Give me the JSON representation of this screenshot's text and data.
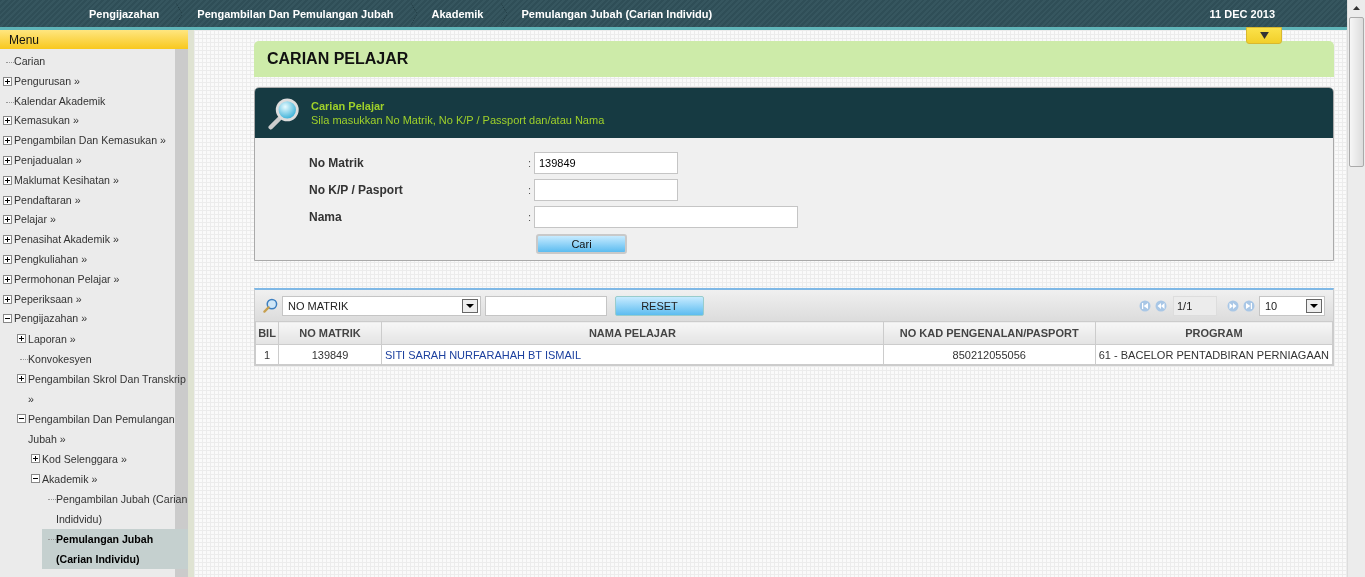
{
  "breadcrumb": [
    {
      "label": "Pengijazahan"
    },
    {
      "label": "Pengambilan Dan Pemulangan Jubah"
    },
    {
      "label": "Akademik"
    },
    {
      "label": "Pemulangan Jubah (Carian Individu)"
    }
  ],
  "date": "11 DEC 2013",
  "sidebar": {
    "title": "Menu",
    "items": [
      {
        "label": "Carian",
        "kind": "leaf",
        "selected": false
      },
      {
        "label": "Pengurusan »",
        "kind": "folder",
        "expanded": false,
        "selected": false
      },
      {
        "label": "Kalendar Akademik",
        "kind": "leaf",
        "selected": false
      },
      {
        "label": "Kemasukan »",
        "kind": "folder",
        "expanded": false,
        "selected": false
      },
      {
        "label": "Pengambilan Dan Kemasukan »",
        "kind": "folder",
        "expanded": false,
        "selected": false
      },
      {
        "label": "Penjadualan »",
        "kind": "folder",
        "expanded": false,
        "selected": false
      },
      {
        "label": "Maklumat Kesihatan »",
        "kind": "folder",
        "expanded": false,
        "selected": false
      },
      {
        "label": "Pendaftaran »",
        "kind": "folder",
        "expanded": false,
        "selected": false
      },
      {
        "label": "Pelajar »",
        "kind": "folder",
        "expanded": false,
        "selected": false
      },
      {
        "label": "Penasihat Akademik »",
        "kind": "folder",
        "expanded": false,
        "selected": false
      },
      {
        "label": "Pengkuliahan »",
        "kind": "folder",
        "expanded": false,
        "selected": false
      },
      {
        "label": "Permohonan Pelajar »",
        "kind": "folder",
        "expanded": false,
        "selected": false
      },
      {
        "label": "Peperiksaan »",
        "kind": "folder",
        "expanded": false,
        "selected": false
      },
      {
        "label": "Pengijazahan »",
        "kind": "folder",
        "expanded": true,
        "selected": false,
        "children": [
          {
            "label": "Laporan »",
            "kind": "folder",
            "expanded": false,
            "selected": false
          },
          {
            "label": "Konvokesyen",
            "kind": "leaf",
            "selected": false
          },
          {
            "label": "Pengambilan Skrol Dan Transkrip »",
            "kind": "folder",
            "expanded": false,
            "selected": false
          },
          {
            "label": "Pengambilan Dan Pemulangan Jubah »",
            "kind": "folder",
            "expanded": true,
            "selected": false,
            "children": [
              {
                "label": "Kod Selenggara »",
                "kind": "folder",
                "expanded": false,
                "selected": false
              },
              {
                "label": "Akademik »",
                "kind": "folder",
                "expanded": true,
                "selected": false,
                "children": [
                  {
                    "label": "Pengambilan Jubah (Carian Indidvidu)",
                    "kind": "leaf",
                    "selected": false
                  },
                  {
                    "label": "Pemulangan Jubah (Carian Individu)",
                    "kind": "leaf",
                    "selected": true
                  }
                ]
              }
            ]
          }
        ]
      }
    ]
  },
  "header_toggle": {
    "collapsed": true
  },
  "page_title": "CARIAN PELAJAR",
  "search_panel": {
    "title": "Carian Pelajar",
    "subtitle": "Sila masukkan No Matrik, No K/P / Passport dan/atau Nama",
    "fields": [
      {
        "label": "No Matrik",
        "colon": ":",
        "kind": "short",
        "value": "139849"
      },
      {
        "label": "No K/P / Pasport",
        "colon": ":",
        "kind": "short"
      },
      {
        "label": "Nama",
        "colon": ":",
        "kind": "long"
      }
    ],
    "button": "Cari"
  },
  "grid": {
    "filter_select": "NO MATRIK",
    "reset_button": "RESET",
    "page": "1/1",
    "page_size": "10",
    "columns": [
      "BIL",
      "NO MATRIK",
      "NAMA PELAJAR",
      "NO KAD PENGENALAN/PASPORT",
      "PROGRAM"
    ],
    "rows": [
      [
        "1",
        "139849",
        "SITI SARAH NURFARAHAH BT ISMAIL",
        "850212055056",
        "61 - BACELOR PENTADBIRAN PERNIAGAAN"
      ]
    ]
  }
}
